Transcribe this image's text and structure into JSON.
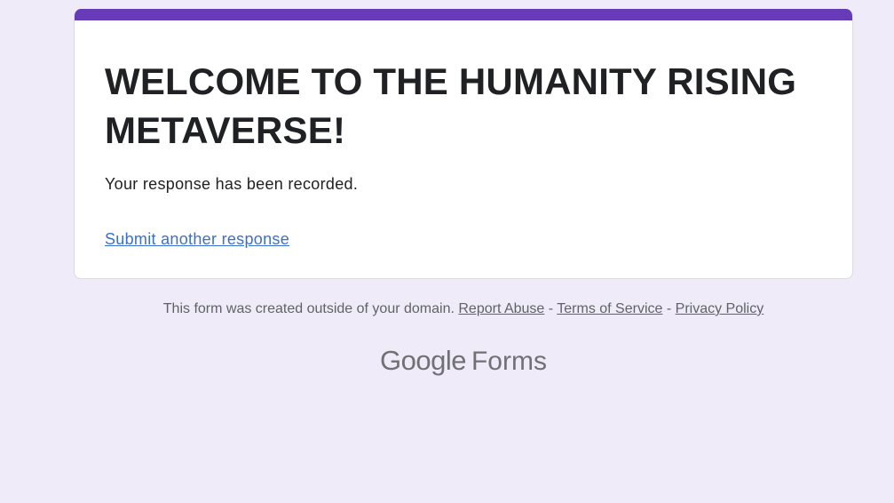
{
  "card": {
    "title": "WELCOME TO THE HUMANITY RISING METAVERSE!",
    "message": "Your response has been recorded.",
    "submit_another_label": "Submit another response",
    "accent_color": "#673ab7"
  },
  "footer": {
    "notice": "This form was created outside of your domain.",
    "report_abuse": "Report Abuse",
    "separator": "-",
    "terms": "Terms of Service",
    "privacy": "Privacy Policy"
  },
  "brand": {
    "google": "Google",
    "product": "Forms"
  },
  "colors": {
    "background": "#efebf8",
    "link": "#3b6fce",
    "text": "#202124"
  }
}
